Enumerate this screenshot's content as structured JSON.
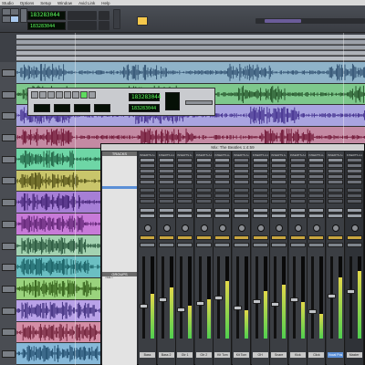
{
  "menubar": {
    "items": [
      "Studio",
      "Options",
      "Setup",
      "Window",
      "Avid Link",
      "Help"
    ]
  },
  "toolbar": {
    "main_counter": "183283044",
    "sub_counter": "183283044"
  },
  "transport": {
    "main_counter": "183283044",
    "sub_counter": "183283044"
  },
  "mix_window": {
    "title": "Mix: The Beatles 1:4:59",
    "tracks_header": "TRACKS",
    "groups_header": "GROUPS",
    "group_rows": [
      "<ALL>"
    ],
    "insert_label": "INSERTS A-E",
    "strip_names": [
      "Bass",
      "Bass 2",
      "Gtr 1",
      "Gtr 2",
      "Kit Tom",
      "Kit Tom",
      "OH",
      "Snare",
      "Kick",
      "Click",
      "Vocal Pos",
      "Master"
    ],
    "selected_strip": 10
  },
  "colors": {
    "track_colors": [
      "#8fb3c9",
      "#7ec88c",
      "#a9a4e0",
      "#c48aa3",
      "#6ed6a6",
      "#c9c56b",
      "#a67fd6",
      "#c87ad8",
      "#a3d2b1",
      "#6bbfc2",
      "#9ad37d",
      "#b9a2e8",
      "#d48ea6",
      "#86b8d8"
    ],
    "wave_colors": [
      "#2e4e6e",
      "#204d24",
      "#3e2b8a",
      "#6b1030",
      "#1d5c3f",
      "#4c4a12",
      "#3c1d6e",
      "#5a1f6f",
      "#1e4d33",
      "#135a5e",
      "#2e5a14",
      "#3b2a7a",
      "#6a1a32",
      "#1c4768"
    ]
  }
}
